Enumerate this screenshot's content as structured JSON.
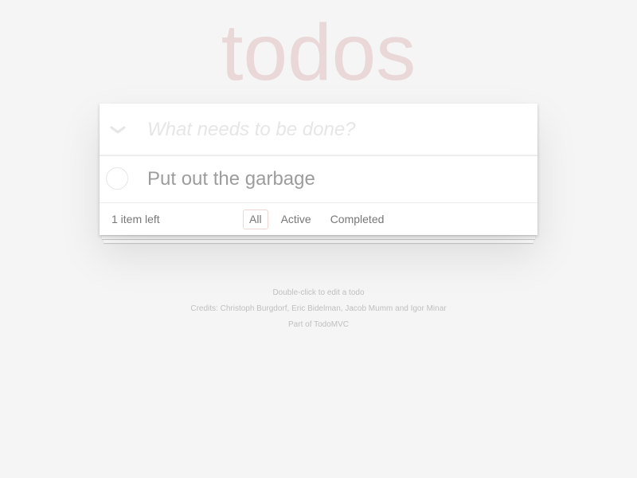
{
  "header": {
    "title": "todos"
  },
  "new_todo": {
    "placeholder": "What needs to be done?",
    "value": "",
    "toggle_all_icon": "chevron-down-icon"
  },
  "todos": [
    {
      "label": "Put out the garbage",
      "completed": false
    }
  ],
  "footer": {
    "count_text": "1 item left",
    "filters": [
      {
        "label": "All",
        "selected": true
      },
      {
        "label": "Active",
        "selected": false
      },
      {
        "label": "Completed",
        "selected": false
      }
    ]
  },
  "info": {
    "hint": "Double-click to edit a todo",
    "credits": "Credits: Christoph Burgdorf, Eric Bidelman, Jacob Mumm and Igor Minar",
    "part_of": "Part of TodoMVC"
  },
  "colors": {
    "background": "#f5f5f5",
    "title": "#ead7d7",
    "selected_filter_border": "#efd5d5",
    "placeholder": "#e6e6e6"
  }
}
